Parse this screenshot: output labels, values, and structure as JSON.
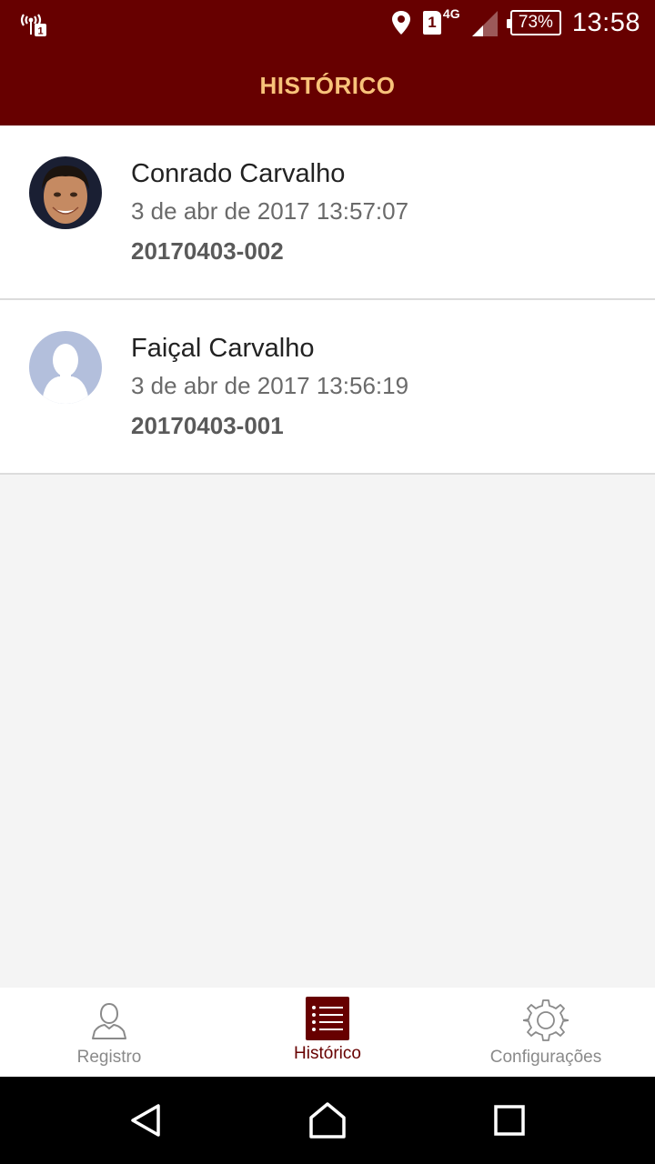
{
  "status_bar": {
    "time": "13:58",
    "battery": "73%",
    "sim_slot": "1",
    "network": "4G",
    "icons": [
      "wifi-hotspot-icon",
      "location-icon",
      "sim-card-icon",
      "cell-signal-icon",
      "battery-icon"
    ]
  },
  "app_bar": {
    "title": "HISTÓRICO",
    "background": "#670000",
    "title_color": "#f8c27a"
  },
  "history": {
    "items": [
      {
        "name": "Conrado Carvalho",
        "date": "3 de abr de 2017 13:57:07",
        "code": "20170403-002",
        "avatar": "user-photo"
      },
      {
        "name": "Faiçal Carvalho",
        "date": "3 de abr de 2017 13:56:19",
        "code": "20170403-001",
        "avatar": "default-profile-placeholder"
      }
    ]
  },
  "bottom_nav": {
    "items": [
      {
        "label": "Registro",
        "icon": "person-icon",
        "active": false
      },
      {
        "label": "Histórico",
        "icon": "list-icon",
        "active": true
      },
      {
        "label": "Configurações",
        "icon": "gear-icon",
        "active": false
      }
    ],
    "active_color": "#670000",
    "inactive_color": "#8a8a8a"
  },
  "system_nav": {
    "buttons": [
      "back-icon",
      "home-icon",
      "recents-icon"
    ]
  }
}
